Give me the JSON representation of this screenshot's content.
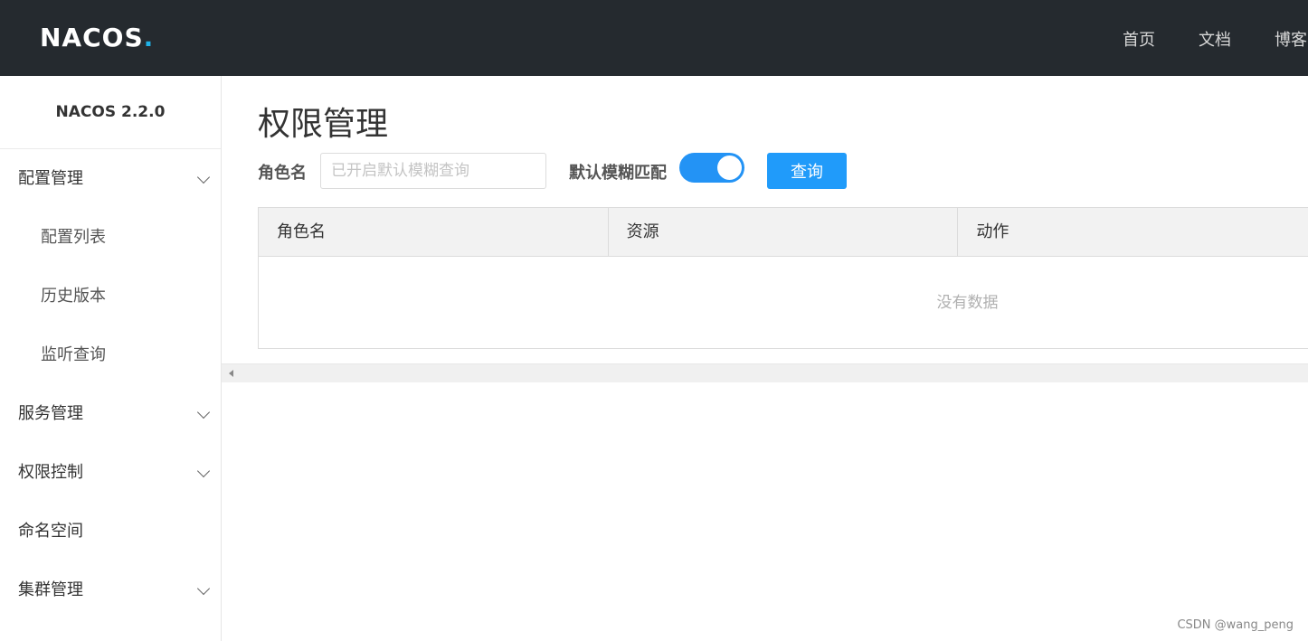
{
  "header": {
    "logo_text": "NACOS",
    "logo_dot": ".",
    "nav": [
      "首页",
      "文档",
      "博客"
    ]
  },
  "sidebar": {
    "version": "NACOS 2.2.0",
    "items": [
      {
        "label": "配置管理",
        "expandable": true
      },
      {
        "label": "配置列表",
        "sub": true
      },
      {
        "label": "历史版本",
        "sub": true
      },
      {
        "label": "监听查询",
        "sub": true
      },
      {
        "label": "服务管理",
        "expandable": true
      },
      {
        "label": "权限控制",
        "expandable": true
      },
      {
        "label": "命名空间"
      },
      {
        "label": "集群管理",
        "expandable": true
      }
    ]
  },
  "main": {
    "title": "权限管理",
    "form": {
      "role_label": "角色名",
      "role_placeholder": "已开启默认模糊查询",
      "fuzzy_label": "默认模糊匹配",
      "fuzzy_enabled": true,
      "query_button": "查询"
    },
    "table": {
      "columns": [
        "角色名",
        "资源",
        "动作"
      ],
      "empty_text": "没有数据"
    }
  },
  "watermark": "CSDN @wang_peng",
  "colors": {
    "topbar": "#252a2f",
    "accent": "#209bfa",
    "logo_accent": "#1fb2e8"
  }
}
